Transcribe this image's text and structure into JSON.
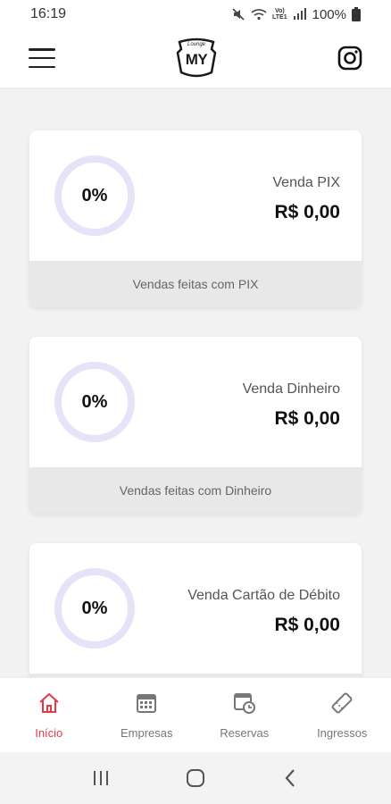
{
  "status_bar": {
    "time": "16:19",
    "lte1": "Vo)",
    "lte2": "LTE1",
    "battery": "100%"
  },
  "header": {
    "logo_top": "Lounge",
    "logo_text": "MY",
    "icons": [
      "menu-icon",
      "instagram-icon"
    ]
  },
  "cards": [
    {
      "percent": "0%",
      "label": "Venda PIX",
      "value": "R$ 0,00",
      "footer": "Vendas feitas com PIX"
    },
    {
      "percent": "0%",
      "label": "Venda Dinheiro",
      "value": "R$ 0,00",
      "footer": "Vendas feitas com Dinheiro"
    },
    {
      "percent": "0%",
      "label": "Venda Cartão de Débito",
      "value": "R$ 0,00",
      "footer": ""
    }
  ],
  "bottom_nav": [
    {
      "label": "Início",
      "icon": "home-icon",
      "active": true
    },
    {
      "label": "Empresas",
      "icon": "calendar-icon",
      "active": false
    },
    {
      "label": "Reservas",
      "icon": "reservation-clock-icon",
      "active": false
    },
    {
      "label": "Ingressos",
      "icon": "ticket-icon",
      "active": false
    }
  ],
  "colors": {
    "accent": "#e63946",
    "ring": "#e4e3f7",
    "card_footer": "#e8e8e8",
    "background": "#f2f2f2"
  }
}
